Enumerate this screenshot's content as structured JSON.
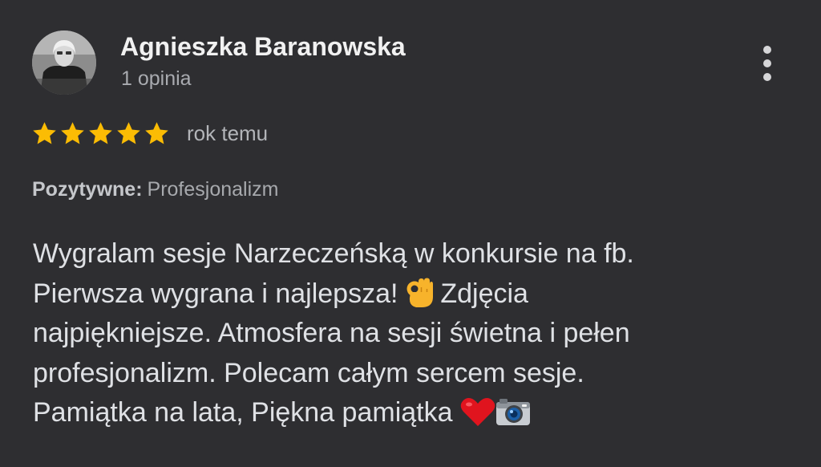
{
  "author": {
    "name": "Agnieszka Baranowska",
    "meta": "1 opinia"
  },
  "rating": {
    "stars": 5,
    "max": 5,
    "time": "rok temu",
    "star_color": "#fbbc04"
  },
  "attributes": {
    "label": "Pozytywne:",
    "value": "Profesjonalizm"
  },
  "review": {
    "lines": [
      "Wygralam sesje Narzeczeńską w konkursie na fb.",
      "Pierwsza wygrana i najlepsza! ",
      "Zdjęcia",
      "najpiękniejsze. Atmosfera na sesji świetna i pełen",
      "profesjonalizm. Polecam całym sercem sesje.",
      "Pamiątka na lata, Piękna pamiątka "
    ],
    "emojis": [
      "ok-hand-emoji",
      "red-heart-emoji",
      "camera-emoji"
    ]
  },
  "colors": {
    "background": "#2e2e31",
    "name": "#f1f1f1",
    "secondary": "#a9abb0",
    "body": "#dfe1e5"
  }
}
